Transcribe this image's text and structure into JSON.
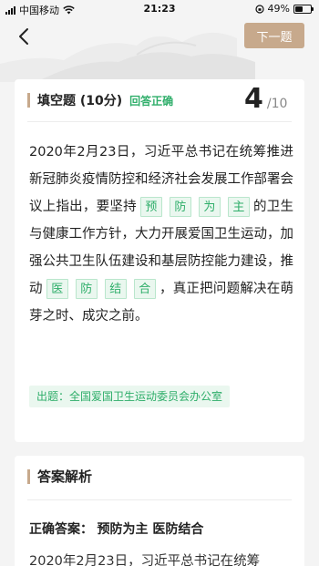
{
  "status_bar": {
    "carrier": "中国移动",
    "time": "21:23",
    "battery": "49%",
    "battery_level": 0.49
  },
  "header": {
    "next_label": "下一题"
  },
  "question": {
    "type": "填空题 (10分)",
    "status": "回答正确",
    "current": "4",
    "total": "/10",
    "segments": [
      {
        "t": "2020年2月23日，习近平总书记在统筹推进新冠肺炎疫情防控和经济社会发展工作部署会议上指出，要坚持"
      },
      {
        "a": [
          "预",
          "防",
          "为",
          "主"
        ]
      },
      {
        "t": "的卫生与健康工作方针，大力开展爱国卫生运动，加强公共卫生队伍建设和基层防控能力建设，推动"
      },
      {
        "a": [
          "医",
          "防",
          "结",
          "合"
        ]
      },
      {
        "t": "，真正把问题解决在萌芽之时、成灾之前。"
      }
    ],
    "source": "出题：全国爱国卫生运动委员会办公室"
  },
  "analysis": {
    "title": "答案解析",
    "correct_label": "正确答案：",
    "correct_value": "预防为主 医防结合",
    "text": "2020年2月23日，习近平总书记在统筹"
  },
  "colors": {
    "accent": "#c7a98c",
    "correct_green": "#2fae6a"
  }
}
